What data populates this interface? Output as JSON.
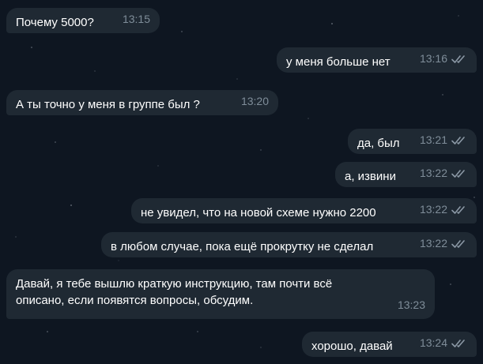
{
  "messages": [
    {
      "text": "Почему 5000?",
      "time": "13:15",
      "direction": "in",
      "read_icon": ""
    },
    {
      "text": "у меня больше нет",
      "time": "13:16",
      "direction": "out",
      "read_icon": "double-check-icon"
    },
    {
      "text": "А ты точно у меня в группе был ?",
      "time": "13:20",
      "direction": "in",
      "read_icon": ""
    },
    {
      "text": "да, был",
      "time": "13:21",
      "direction": "out",
      "read_icon": "double-check-icon"
    },
    {
      "text": "а, извини",
      "time": "13:22",
      "direction": "out",
      "read_icon": "double-check-icon"
    },
    {
      "text": "не увидел, что на новой схеме нужно 2200",
      "time": "13:22",
      "direction": "out",
      "read_icon": "double-check-icon"
    },
    {
      "text": "в любом случае, пока ещё прокрутку не сделал",
      "time": "13:22",
      "direction": "out",
      "read_icon": "double-check-icon"
    },
    {
      "text": "Давай, я тебе вышлю краткую инструкцию, там почти всё\nописано, если появятся вопросы, обсудим.",
      "time": "13:23",
      "direction": "in",
      "read_icon": ""
    },
    {
      "text": "хорошо, давай",
      "time": "13:24",
      "direction": "out",
      "read_icon": "double-check-icon"
    }
  ],
  "colors": {
    "background": "#0e1621",
    "bubble": "#1f2933",
    "text": "#ffffff",
    "time": "#7f8d99",
    "ticks": "#8b98a5"
  }
}
